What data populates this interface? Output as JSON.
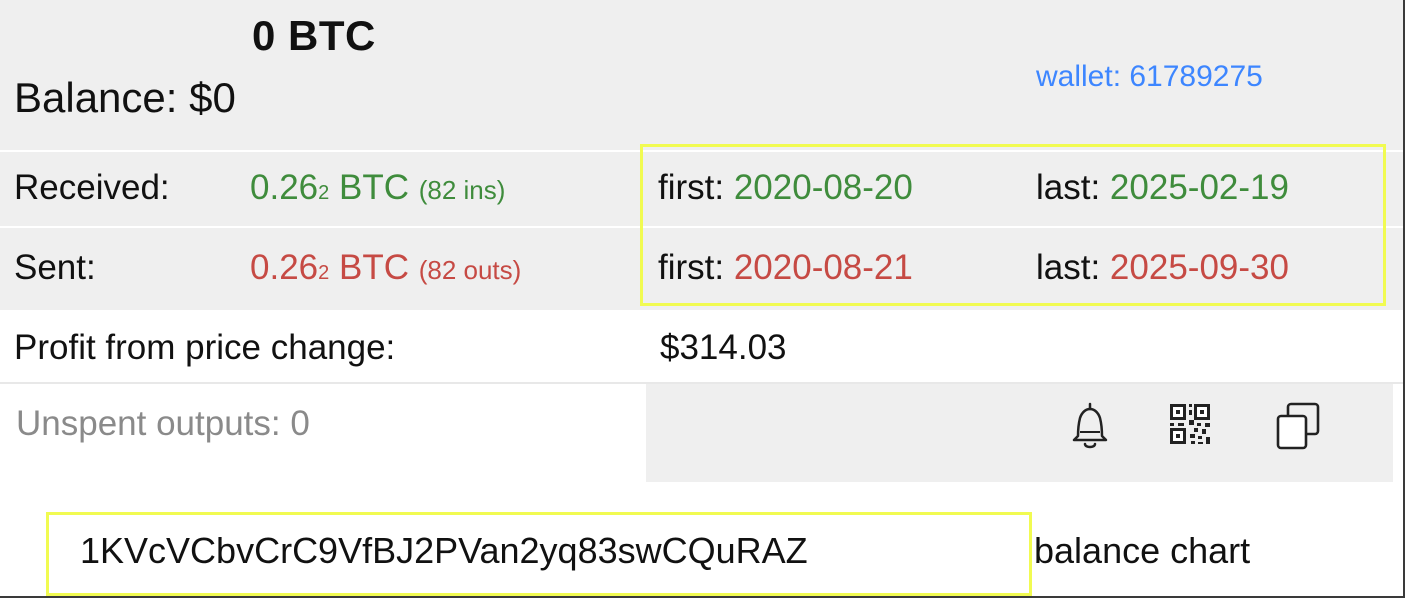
{
  "header": {
    "btc_amount": "0 BTC",
    "balance": "Balance: $0",
    "wallet_link": "wallet: 61789275"
  },
  "received": {
    "label": "Received:",
    "amount_main": "0.26",
    "amount_sub": "2",
    "unit": " BTC ",
    "count": "(82 ins)",
    "first_label": "first: ",
    "first_date": "2020-08-20",
    "last_label": "last: ",
    "last_date": "2025-02-19"
  },
  "sent": {
    "label": "Sent:",
    "amount_main": "0.26",
    "amount_sub": "2",
    "unit": " BTC ",
    "count": "(82 outs)",
    "first_label": "first: ",
    "first_date": "2020-08-21",
    "last_label": "last: ",
    "last_date": "2025-09-30"
  },
  "profit": {
    "label": "Profit from price change:",
    "value": "$314.03"
  },
  "unspent": {
    "label": "Unspent outputs: 0"
  },
  "actions": {
    "icons": [
      "bell-icon",
      "qr-code-icon",
      "copy-icon"
    ]
  },
  "footer": {
    "address": "1KVcVCbvCrC9VfBJ2PVan2yq83swCQuRAZ",
    "chart_link": "balance chart"
  },
  "colors": {
    "green": "#3f8c3c",
    "red": "#c64a44",
    "link": "#3d86ff",
    "highlight": "#f1fb51"
  }
}
